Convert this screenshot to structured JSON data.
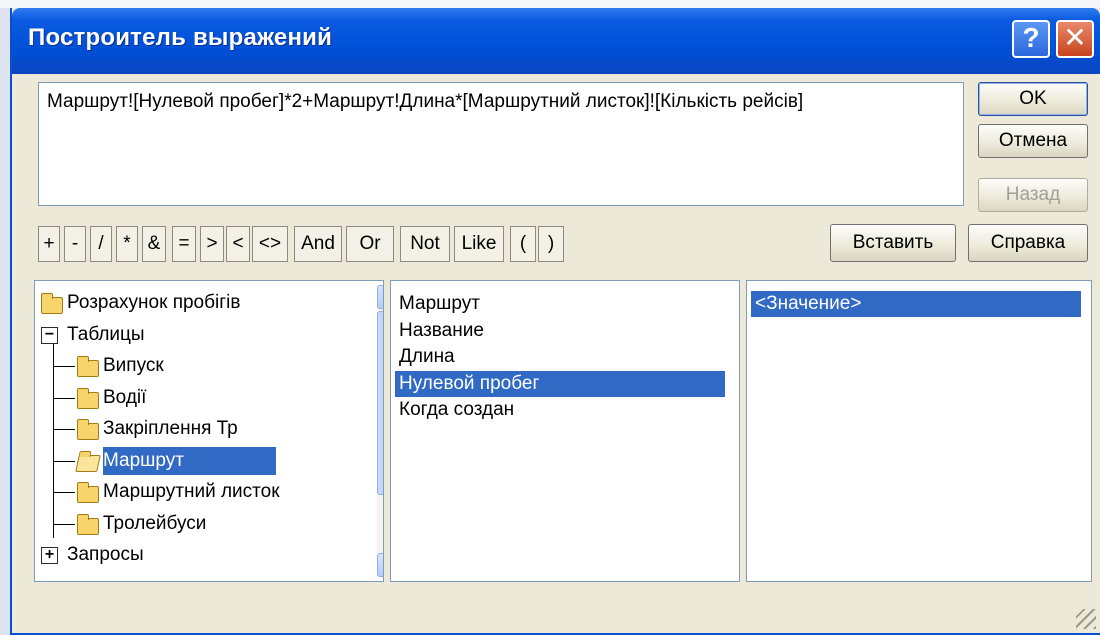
{
  "dialog": {
    "title": "Построитель выражений",
    "help_glyph": "?",
    "close_glyph": "✕"
  },
  "expression": {
    "text": "Маршрут![Нулевой пробег]*2+Маршрут!Длина*[Маршрутний листок]![Кількість рейсів]"
  },
  "buttons": {
    "ok": "OK",
    "cancel": "Отмена",
    "back": "Назад",
    "paste": "Вставить",
    "help": "Справка"
  },
  "operators": [
    "+",
    "-",
    "/",
    "*",
    "&",
    "=",
    ">",
    "<",
    "<>",
    "And",
    "Or",
    "Not",
    "Like",
    "(",
    ")"
  ],
  "tree": {
    "items": [
      {
        "label": "Розрахунок пробігів",
        "icon": "folder-icon"
      },
      {
        "label": "Таблицы",
        "icon": "collapse-icon"
      },
      {
        "label": "Випуск",
        "icon": "folder-icon"
      },
      {
        "label": "Водії",
        "icon": "folder-icon"
      },
      {
        "label": "Закріплення Тр",
        "icon": "folder-icon"
      },
      {
        "label": "Маршрут",
        "icon": "open-folder-icon",
        "selected": true
      },
      {
        "label": "Маршрутний листок",
        "icon": "folder-icon"
      },
      {
        "label": "Тролейбуси",
        "icon": "folder-icon"
      },
      {
        "label": "Запросы",
        "icon": "expand-icon"
      }
    ],
    "collapse_glyph": "−",
    "expand_glyph": "+"
  },
  "fields": {
    "items": [
      "Маршрут",
      "Название",
      "Длина",
      "Нулевой пробег",
      "Когда создан"
    ],
    "selected": "Нулевой пробег"
  },
  "values": {
    "items": [
      "<Значение>"
    ],
    "selected": "<Значение>"
  },
  "scrollbar": {
    "up_glyph": "⌃",
    "down_glyph": "⌄",
    "grip_glyph": "≡"
  },
  "colors": {
    "selection": "#316ac5",
    "titlebar": "#0050d8",
    "dialog_bg": "#ece9d8"
  }
}
